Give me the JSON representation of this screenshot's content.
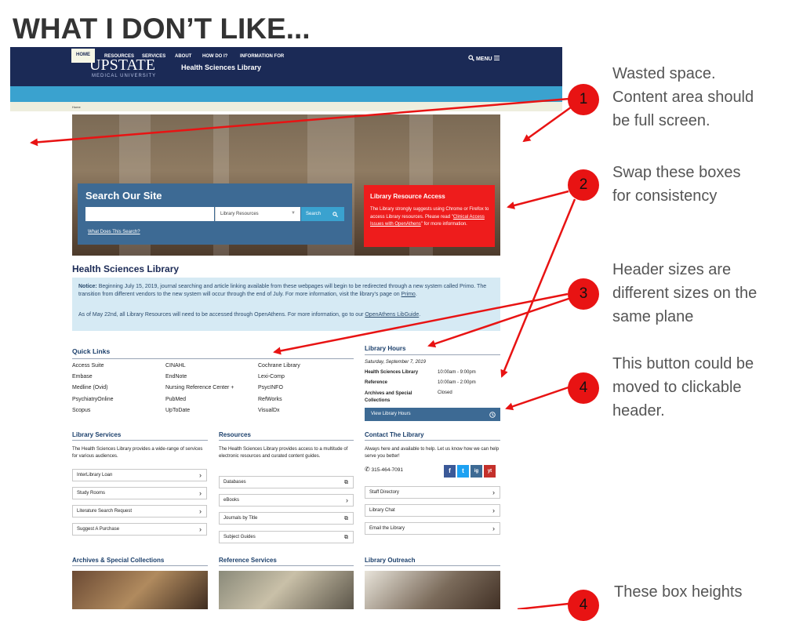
{
  "slide": {
    "title": "WHAT I DON’T LIKE..."
  },
  "header": {
    "logo": "UPSTATE",
    "logo_sub": "MEDICAL UNIVERSITY",
    "site_name": "Health Sciences Library",
    "menu_label": "MENU",
    "search_icon": "search-icon",
    "menu_icon": "hamburger-icon"
  },
  "nav": {
    "items": [
      "HOME",
      "RESOURCES",
      "SERVICES",
      "ABOUT",
      "HOW DO I?",
      "INFORMATION FOR"
    ]
  },
  "breadcrumb": "Home",
  "search": {
    "title": "Search Our Site",
    "input_value": "",
    "select_value": "Library Resources",
    "button": "Search",
    "help_link": "What Does This Search?"
  },
  "resource_access": {
    "title": "Library Resource Access",
    "body_pre": "The Library strongly suggests using Chrome or Firefox to access Library resources. Please read \"",
    "body_link": "Clinical Access Issues with OpenAthens",
    "body_post": "\" for more information."
  },
  "page_title": "Health Sciences Library",
  "notice": {
    "label": "Notice:",
    "text": "Beginning July 15, 2019, journal searching and article linking available from these webpages will begin to be redirected through a new system called Primo. The transition from different vendors to the new system will occur through the end of July. For more information, visit the library's page on ",
    "link": "Primo",
    "text_end": ".",
    "p2": "As of May 22nd, all Library Resources will need to be accessed through OpenAthens. For more information, go to our ",
    "p2_link": "OpenAthens LibGuide",
    "p2_end": "."
  },
  "quick_links": {
    "title": "Quick Links",
    "items": [
      "Access Suite",
      "CINAHL",
      "Cochrane Library",
      "Embase",
      "EndNote",
      "Lexi-Comp",
      "Medline (Ovid)",
      "Nursing Reference Center +",
      "PsycINFO",
      "PsychiatryOnline",
      "PubMed",
      "RefWorks",
      "Scopus",
      "UpToDate",
      "VisualDx"
    ]
  },
  "hours": {
    "title": "Library Hours",
    "date": "Saturday, September 7, 2019",
    "rows": [
      {
        "name": "Health Sciences Library",
        "time": "10:00am - 9:00pm"
      },
      {
        "name": "Reference",
        "time": "10:00am - 2:00pm"
      },
      {
        "name": "Archives and Special Collections",
        "time": "Closed"
      }
    ],
    "button": "View Library Hours"
  },
  "services": {
    "title": "Library Services",
    "desc": "The Health Sciences Library provides a wide-range of services for various audiences.",
    "items": [
      "InterLibrary Loan",
      "Study Rooms",
      "Literature Search Request",
      "Suggest A Purchase"
    ]
  },
  "resources": {
    "title": "Resources",
    "desc": "The Health Sciences Library provides access to a multitude of electronic resources and curated content guides.",
    "items": [
      "Databases",
      "eBooks",
      "Journals by Title",
      "Subject Guides"
    ]
  },
  "contact": {
    "title": "Contact The Library",
    "desc": "Always here and available to help. Let us know how we can help serve you better!",
    "phone": "315-464-7091",
    "items": [
      "Staff Directory",
      "Library Chat",
      "Email the Library"
    ],
    "social": [
      "f",
      "t",
      "ig",
      "yt"
    ]
  },
  "bottom": {
    "titles": [
      "Archives & Special Collections",
      "Reference Services",
      "Library Outreach"
    ]
  },
  "annotations": [
    {
      "num": "1",
      "text": [
        "Wasted space.",
        "Content area should",
        "be full screen."
      ]
    },
    {
      "num": "2",
      "text": [
        "Swap these boxes",
        "for consistency"
      ]
    },
    {
      "num": "3",
      "text": [
        "Header sizes are",
        "different sizes on the",
        "same plane"
      ]
    },
    {
      "num": "4",
      "text": [
        "This button could be",
        "moved to clickable",
        "header."
      ]
    },
    {
      "num": "4",
      "text": [
        "These box heights"
      ]
    }
  ]
}
